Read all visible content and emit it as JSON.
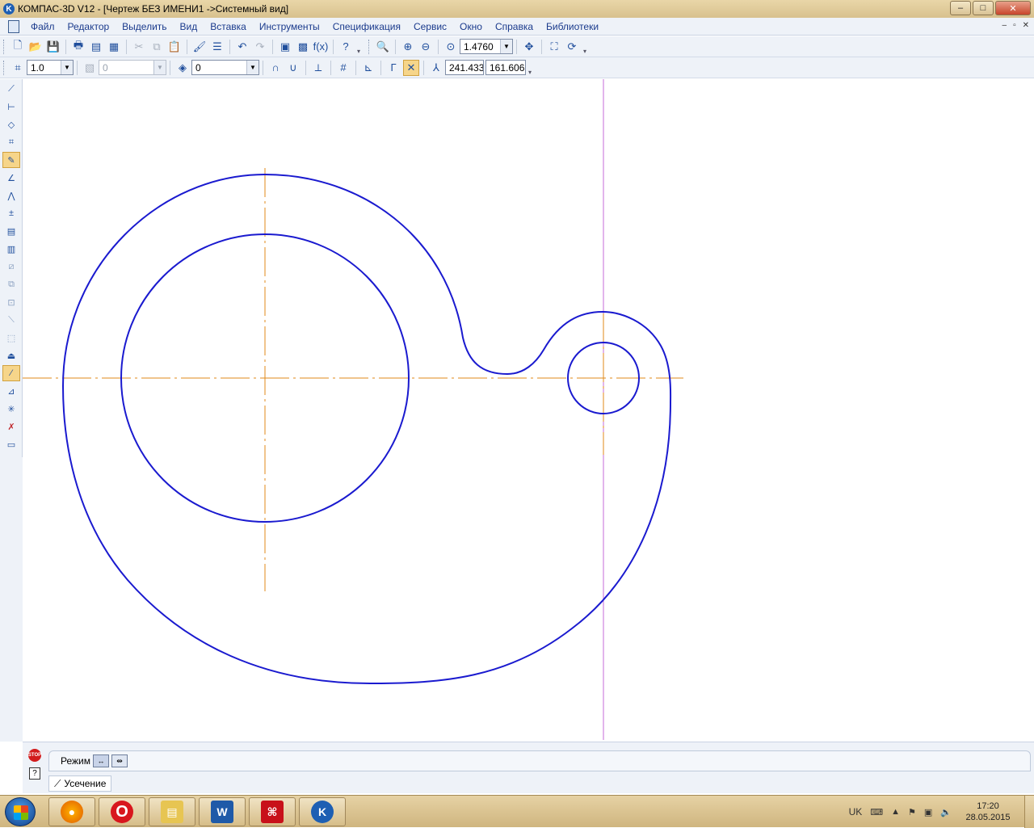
{
  "window": {
    "title": "КОМПАС-3D V12 - [Чертеж БЕЗ ИМЕНИ1 ->Системный вид]",
    "app_icon": "kompas-logo-icon",
    "minimize": "–",
    "maximize": "□",
    "close": "✕"
  },
  "menu": {
    "items": [
      "Файл",
      "Редактор",
      "Выделить",
      "Вид",
      "Вставка",
      "Инструменты",
      "Спецификация",
      "Сервис",
      "Окно",
      "Справка",
      "Библиотеки"
    ],
    "mdi_minimize": "–",
    "mdi_restore": "▫",
    "mdi_close": "✕"
  },
  "toolbar1": {
    "zoom_value": "1.4760",
    "icons": [
      "new-document-icon",
      "open-folder-icon",
      "save-icon",
      "print-icon",
      "print-preview-icon",
      "print-setup-icon",
      "cut-icon",
      "copy-icon",
      "paste-icon",
      "format-painter-icon",
      "properties-icon",
      "undo-icon",
      "redo-icon",
      "manager-icon",
      "library-icon",
      "variables-icon",
      "help-pointer-icon",
      "zoom-window-icon",
      "zoom-in-icon",
      "zoom-out-icon",
      "zoom-scale-icon",
      "pan-icon",
      "show-all-icon",
      "refresh-icon"
    ],
    "fx_label": "f(x)"
  },
  "toolbar2": {
    "step_value": "1.0",
    "view_value": "0",
    "layer_value": "0",
    "coord_x": "241.433",
    "coord_y": "161.606",
    "icons": [
      "cursor-step-icon",
      "view-icon",
      "layers-icon",
      "snap-magnet-icon",
      "snap-settings-icon",
      "ortho-icon",
      "grid-icon",
      "local-cs-icon",
      "round-icon",
      "snap-point-icon",
      "coordinates-icon"
    ]
  },
  "left_toolbar": {
    "icons": [
      "geometry-icon",
      "dimensions-icon",
      "symbols-icon",
      "edit-icon",
      "parameterization-icon",
      "measure-icon",
      "selection-icon",
      "associative-view-icon",
      "spec-icon",
      "reports-icon",
      "point-icon",
      "line-icon",
      "circle-icon",
      "arc-icon",
      "ellipse-icon",
      "polyline-icon",
      "hatch-icon",
      "trim-curve-icon",
      "break-curve-icon",
      "fillet-icon",
      "delete-part-icon",
      "equidistant-icon",
      "contour-icon"
    ],
    "active_index": 15
  },
  "drawing": {
    "outline_color": "#1a1acf",
    "axis_color": "#e08a1a",
    "cursor_color": "#c46bd8"
  },
  "property_panel": {
    "mode_label": "Режим",
    "command_label": "Усечение",
    "stop_label": "STOP",
    "help_label": "?"
  },
  "taskbar": {
    "apps": [
      "firefox-icon",
      "opera-icon",
      "explorer-icon",
      "word-icon",
      "acrobat-icon",
      "kompas-icon"
    ],
    "language": "UK",
    "time": "17:20",
    "date": "28.05.2015"
  }
}
